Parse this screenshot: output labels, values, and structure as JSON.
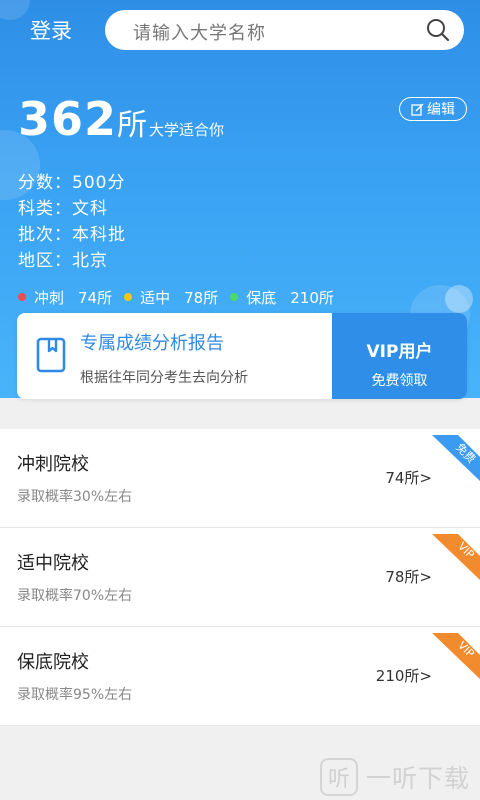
{
  "topbar": {
    "login_label": "登录",
    "search_placeholder": "请输入大学名称",
    "search_icon": "search-icon"
  },
  "summary": {
    "count": "362",
    "unit": "所",
    "description": "大学适合你",
    "edit_label": "编辑",
    "edit_icon": "edit-icon"
  },
  "info": [
    {
      "label": "分数",
      "value": "500分"
    },
    {
      "label": "科类",
      "value": "文科"
    },
    {
      "label": "批次",
      "value": "本科批"
    },
    {
      "label": "地区",
      "value": "北京"
    }
  ],
  "stats": [
    {
      "label": "冲刺",
      "count": "74所",
      "color": "#f24b4b"
    },
    {
      "label": "适中",
      "count": "78所",
      "color": "#f5c518"
    },
    {
      "label": "保底",
      "count": "210所",
      "color": "#4cd964"
    }
  ],
  "report": {
    "title": "专属成绩分析报告",
    "subtitle": "根据往年同分考生去向分析",
    "icon": "book-icon",
    "vip_title": "VIP用户",
    "vip_subtitle": "免费领取"
  },
  "list": [
    {
      "title": "冲刺院校",
      "subtitle": "录取概率30%左右",
      "count": "74所>",
      "badge": "免费",
      "badge_color": "#3b9bf0"
    },
    {
      "title": "适中院校",
      "subtitle": "录取概率70%左右",
      "count": "78所>",
      "badge": "VIP",
      "badge_color": "#f28a2e"
    },
    {
      "title": "保底院校",
      "subtitle": "录取概率95%左右",
      "count": "210所>",
      "badge": "VIP",
      "badge_color": "#f28a2e"
    }
  ],
  "watermark": {
    "icon_char": "听",
    "text": "一听下载"
  },
  "colors": {
    "header_blue": "#3aa2f3",
    "accent_blue": "#2f8ae5",
    "vip_orange": "#f28a2e"
  }
}
